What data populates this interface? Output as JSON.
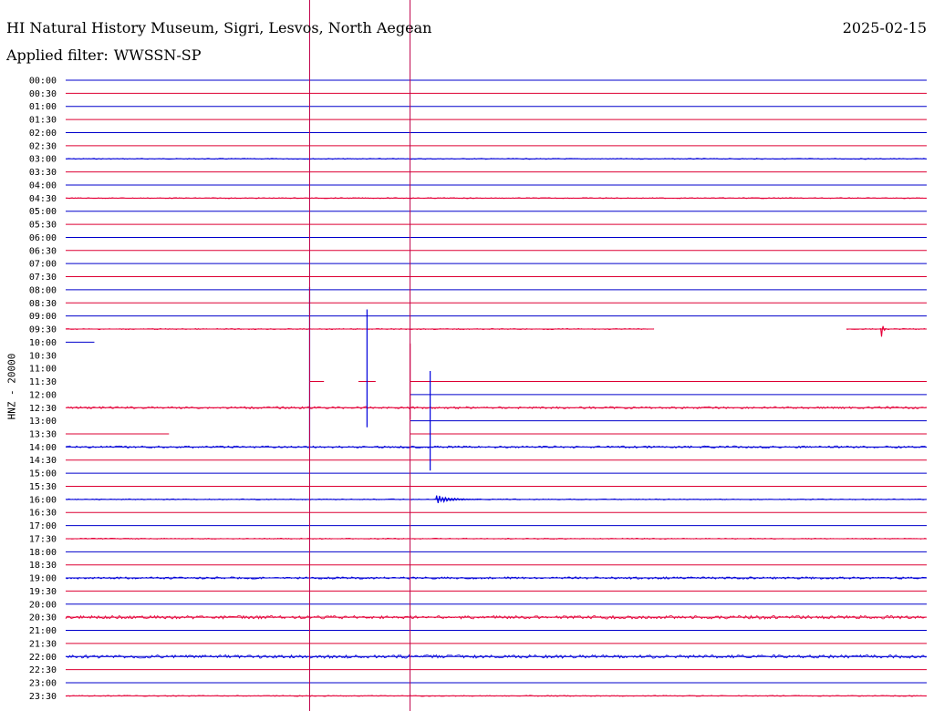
{
  "header": {
    "station": "HI Natural History Museum, Sigri, Lesvos, North Aegean",
    "filter_label": "Applied filter:",
    "filter_value": "WWSSN-SP",
    "date": "2025-02-15"
  },
  "colors": {
    "line_a": "#0000cc",
    "line_b": "#dd0033",
    "trace_blue": "#0000dd",
    "trace_red": "#e8003a",
    "marker": "#c0004a",
    "text": "#000000"
  },
  "chart_data": {
    "type": "line",
    "subtype": "helicorder",
    "ylabel": "HNZ - 20000",
    "row_labels": [
      "00:00",
      "00:30",
      "01:00",
      "01:30",
      "02:00",
      "02:30",
      "03:00",
      "03:30",
      "04:00",
      "04:30",
      "05:00",
      "05:30",
      "06:00",
      "06:30",
      "07:00",
      "07:30",
      "08:00",
      "08:30",
      "09:00",
      "09:30",
      "10:00",
      "10:30",
      "11:00",
      "11:30",
      "12:00",
      "12:30",
      "13:00",
      "13:30",
      "14:00",
      "14:30",
      "15:00",
      "15:30",
      "16:00",
      "16:30",
      "17:00",
      "17:30",
      "18:00",
      "18:30",
      "19:00",
      "19:30",
      "20:00",
      "20:30",
      "21:00",
      "21:30",
      "22:00",
      "22:30",
      "23:00",
      "23:30"
    ],
    "minutes_per_row": 30,
    "row_colors": [
      "blue",
      "red"
    ],
    "grid": false,
    "noise_level": [
      0,
      0,
      0,
      0,
      0,
      0,
      1,
      0,
      0,
      1,
      0,
      0,
      0,
      0,
      0,
      0,
      0,
      0,
      0,
      1,
      0,
      0,
      0,
      0,
      0,
      2,
      0,
      0,
      2,
      0,
      0,
      0,
      1,
      0,
      0,
      1,
      0,
      0,
      2,
      0,
      0,
      3,
      0,
      0,
      3,
      0,
      0,
      1
    ],
    "vertical_markers_min": [
      8.5,
      12.0
    ],
    "data_gaps": [
      {
        "row": "09:30",
        "from_min": 20.5,
        "to_min": 27.2
      },
      {
        "row": "10:00",
        "from_min": 1.0,
        "to_min": 30.0
      },
      {
        "row": "10:30",
        "from_min": 0.0,
        "to_min": 30.0
      },
      {
        "row": "11:00",
        "from_min": 0.0,
        "to_min": 30.0
      },
      {
        "row": "11:30",
        "from_min": 0.0,
        "to_min": 8.5
      },
      {
        "row": "11:30",
        "from_min": 9.0,
        "to_min": 10.2
      },
      {
        "row": "11:30",
        "from_min": 10.8,
        "to_min": 12.0
      },
      {
        "row": "12:00",
        "from_min": 0.0,
        "to_min": 12.0
      },
      {
        "row": "13:00",
        "from_min": 0.0,
        "to_min": 12.0
      },
      {
        "row": "13:30",
        "from_min": 3.6,
        "to_min": 12.0
      }
    ],
    "events": [
      {
        "row": "09:30",
        "minute": 28.4,
        "amplitude": 0.9,
        "duration_min": 0.2
      },
      {
        "row": "11:00",
        "minute": 8.5,
        "amplitude": 6.2,
        "duration_min": 0.1
      },
      {
        "row": "11:00",
        "minute": 10.5,
        "amplitude": 4.5,
        "duration_min": 0.1
      },
      {
        "row": "11:30",
        "minute": 12.0,
        "amplitude": 2.9,
        "duration_min": 0.1
      },
      {
        "row": "13:00",
        "minute": 12.7,
        "amplitude": 3.8,
        "duration_min": 0.1
      },
      {
        "row": "16:00",
        "minute": 12.9,
        "amplitude": 0.35,
        "duration_min": 1.6
      }
    ]
  }
}
